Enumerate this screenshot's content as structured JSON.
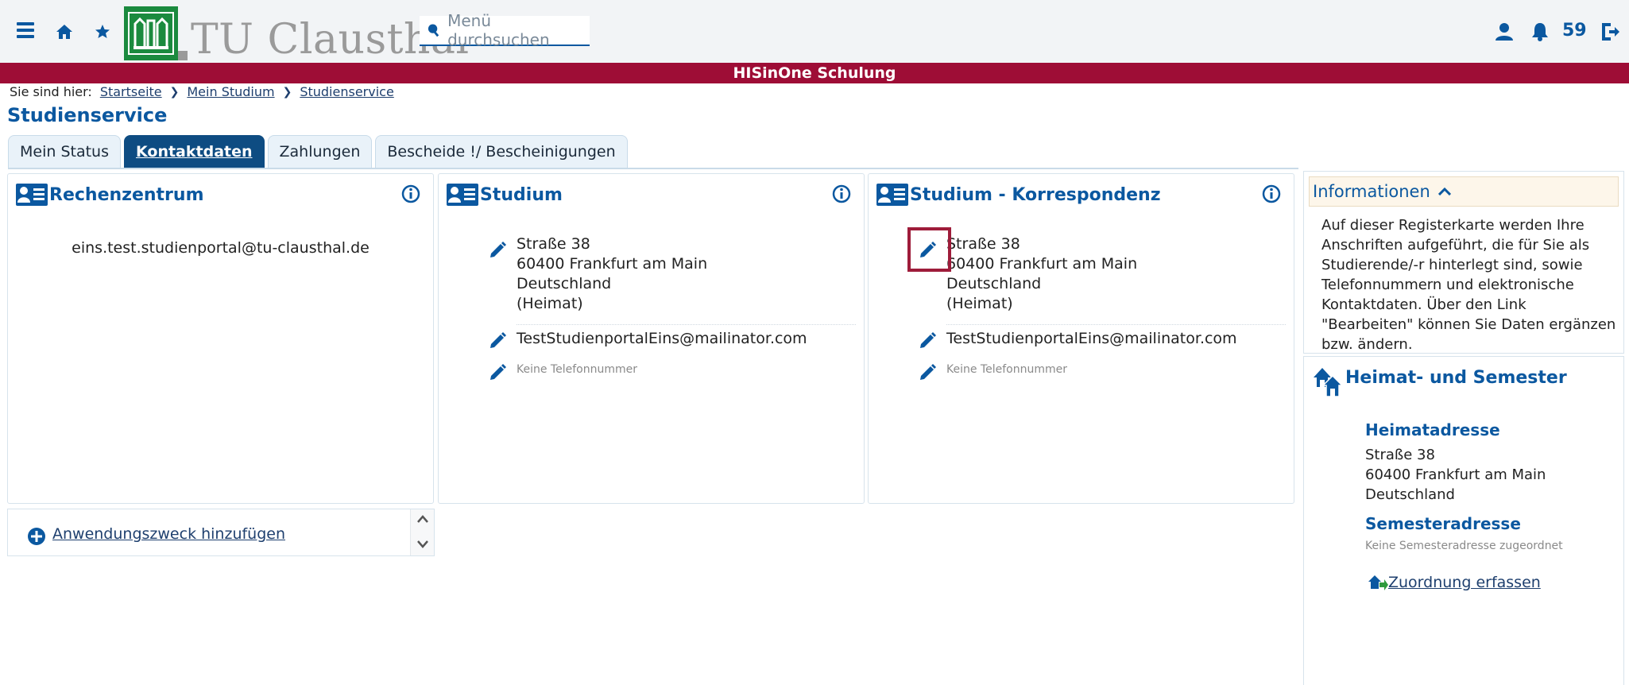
{
  "header": {
    "logo_text": "TU Clausthal",
    "search_placeholder": "Menü durchsuchen",
    "notification_count": "59",
    "band_title": "HISinOne Schulung"
  },
  "breadcrumb": {
    "prefix": "Sie sind hier:",
    "items": [
      "Startseite",
      "Mein Studium",
      "Studienservice"
    ]
  },
  "page_title": "Studienservice",
  "tabs": [
    {
      "label": "Mein Status",
      "active": false
    },
    {
      "label": "Kontaktdaten",
      "active": true
    },
    {
      "label": "Zahlungen",
      "active": false
    },
    {
      "label": "Bescheide !/ Bescheinigungen",
      "active": false
    }
  ],
  "cards": {
    "rechenzentrum": {
      "title": "Rechenzentrum",
      "email": "eins.test.studienportal@tu-clausthal.de"
    },
    "studium": {
      "title": "Studium",
      "address": [
        "Straße 38",
        "60400 Frankfurt am Main",
        "Deutschland",
        "(Heimat)"
      ],
      "email": "TestStudienportalEins@mailinator.com",
      "phone": "Keine Telefonnummer"
    },
    "korrespondenz": {
      "title": "Studium - Korrespondenz",
      "address": [
        "Straße 38",
        "60400 Frankfurt am Main",
        "Deutschland",
        "(Heimat)"
      ],
      "email": "TestStudienportalEins@mailinator.com",
      "phone": "Keine Telefonnummer"
    }
  },
  "add_purpose": "Anwendungszweck hinzufügen",
  "sidebar": {
    "info_title": "Informationen",
    "info_text": "Auf dieser Registerkarte werden Ihre Anschriften aufgeführt, die für Sie als Studierende/-r hinterlegt sind, sowie Telefonnummern und elektronische Kontaktdaten. Über den Link \"Bearbeiten\" können Sie Daten ergänzen bzw. ändern.",
    "heimat_title": "Heimat- und Semester",
    "heimatadresse_label": "Heimatadresse",
    "heimatadresse": [
      "Straße 38",
      "60400 Frankfurt am Main",
      "Deutschland"
    ],
    "semesteradresse_label": "Semesteradresse",
    "semesteradresse_text": "Keine Semesteradresse zugeordnet",
    "zuordnung": "Zuordnung erfassen"
  },
  "colors": {
    "brand_blue": "#0b58a0",
    "band_red": "#9e0d36",
    "logo_green": "#1b8a3e",
    "active_tab": "#0e4c82"
  }
}
